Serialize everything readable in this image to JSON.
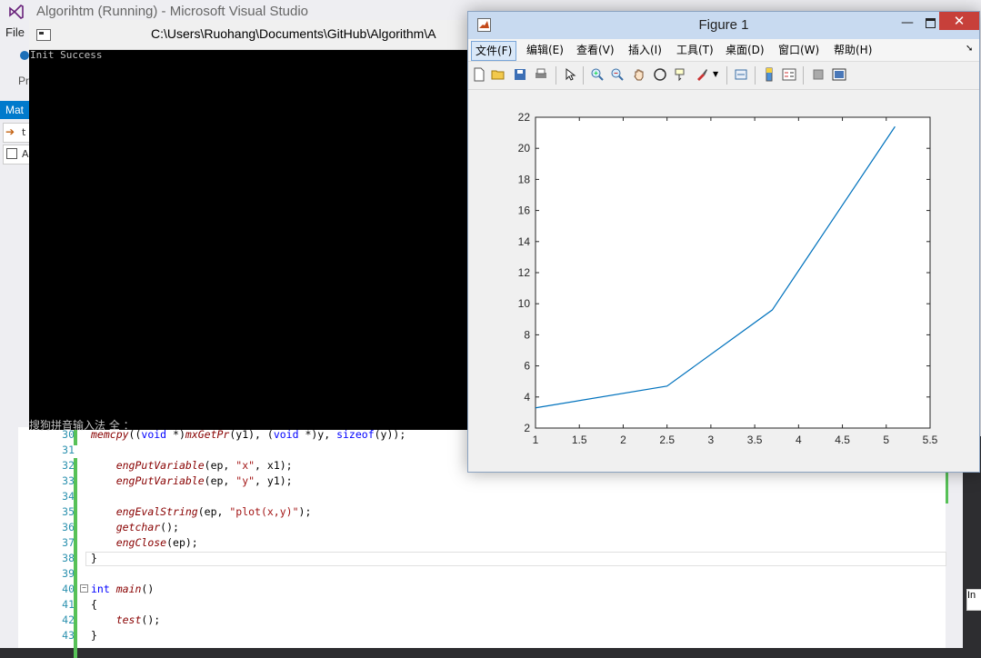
{
  "vs": {
    "title": "Algorihtm (Running) - Microsoft Visual Studio",
    "menu_file": "File",
    "toolbar_partial": "Pr",
    "doc_tab": "Mat",
    "nav1_text": "t",
    "nav2_text": "A",
    "right_tab": "In"
  },
  "console": {
    "title_path": "C:\\Users\\Ruohang\\Documents\\GitHub\\Algorithm\\A",
    "output": "Init Success",
    "ime_status": "搜狗拼音输入法 全 ："
  },
  "editor": {
    "lines": [
      {
        "num": "30",
        "text": "    memcpy((void *)mxGetPr(y1), (void *)y, sizeof(y));"
      },
      {
        "num": "31",
        "text": ""
      },
      {
        "num": "32",
        "text": "    engPutVariable(ep, \"x\", x1);"
      },
      {
        "num": "33",
        "text": "    engPutVariable(ep, \"y\", y1);"
      },
      {
        "num": "34",
        "text": ""
      },
      {
        "num": "35",
        "text": "    engEvalString(ep, \"plot(x,y)\");"
      },
      {
        "num": "36",
        "text": "    getchar();"
      },
      {
        "num": "37",
        "text": "    engClose(ep);"
      },
      {
        "num": "38",
        "text": "}"
      },
      {
        "num": "39",
        "text": ""
      },
      {
        "num": "40",
        "text": "int main()"
      },
      {
        "num": "41",
        "text": "{"
      },
      {
        "num": "42",
        "text": "    test();"
      },
      {
        "num": "43",
        "text": "}"
      }
    ]
  },
  "figure": {
    "title": "Figure 1",
    "minimize": "—",
    "close": "✕",
    "menu": [
      "文件(F)",
      "编辑(E)",
      "查看(V)",
      "插入(I)",
      "工具(T)",
      "桌面(D)",
      "窗口(W)",
      "帮助(H)"
    ],
    "toolbar_icons": [
      "new-file-icon",
      "open-folder-icon",
      "save-icon",
      "print-icon",
      "select-arrow-icon",
      "zoom-in-icon",
      "zoom-out-icon",
      "pan-hand-icon",
      "rotate-3d-icon",
      "data-cursor-icon",
      "brush-icon",
      "link-icon",
      "colorbar-icon",
      "legend-icon",
      "hide-tools-icon",
      "show-tools-icon"
    ]
  },
  "chart_data": {
    "type": "line",
    "x": [
      1,
      2.5,
      3.7,
      5.1
    ],
    "series": [
      {
        "values": [
          3.3,
          4.7,
          9.6,
          21.4
        ],
        "color": "#0072bd"
      }
    ],
    "xlim": [
      1,
      5.5
    ],
    "ylim": [
      2,
      22
    ],
    "xticks": [
      "1",
      "1.5",
      "2",
      "2.5",
      "3",
      "3.5",
      "4",
      "4.5",
      "5",
      "5.5"
    ],
    "yticks": [
      "2",
      "4",
      "6",
      "8",
      "10",
      "12",
      "14",
      "16",
      "18",
      "20",
      "22"
    ],
    "grid": false
  }
}
